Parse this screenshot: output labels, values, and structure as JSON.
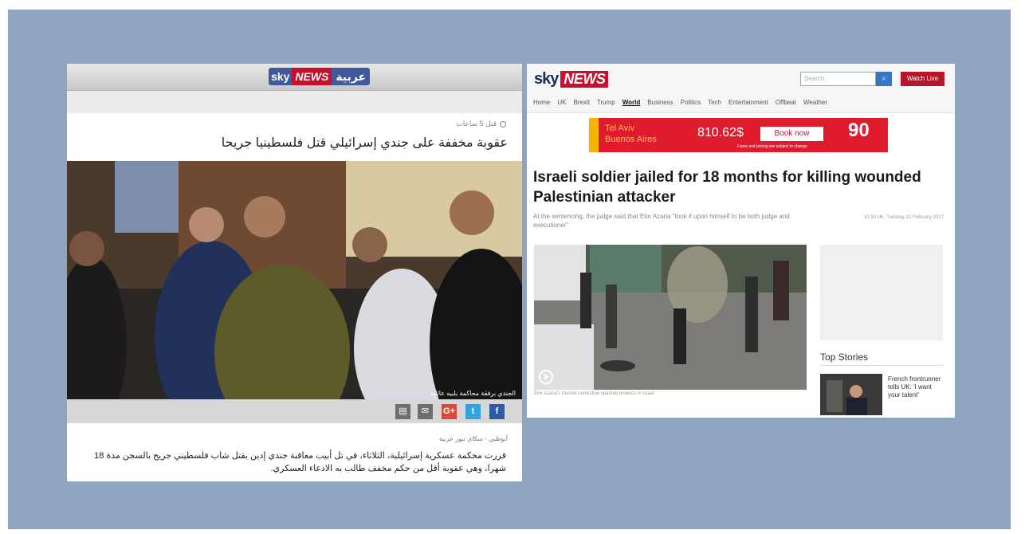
{
  "left_page": {
    "logo": {
      "sky": "sky",
      "news": "NEWS",
      "arabia": "عربية"
    },
    "meta": "قبل 5 ساعات",
    "title": "عقوبة مخففة على جندي إسرائيلي قتل فلسطينيا جريحا",
    "photo_caption": "الجندي برفقة محاكمة بلبيه عائلته",
    "share_icons": [
      "print-icon",
      "email-icon",
      "google-plus-icon",
      "twitter-icon",
      "facebook-icon"
    ],
    "share_labels": {
      "gplus": "G+",
      "facebook": "f",
      "twitter": "t"
    },
    "source": "أبوظبي - سكاي نيوز عربية",
    "body": "قررت محكمة عسكرية إسرائيلية، الثلاثاء، في تل أبيب معاقبة جندي إدين بقتل شاب فلسطيني جريح بالسجن مدة 18 شهرا، وهي عقوبة أقل من حكم مخفف طالب به الادعاء العسكري."
  },
  "right_page": {
    "logo": {
      "sky": "sky",
      "news": "NEWS"
    },
    "search_placeholder": "Search",
    "watch_live": "Watch Live",
    "nav": [
      "Home",
      "UK",
      "Brexit",
      "Trump",
      "World",
      "Business",
      "Politics",
      "Tech",
      "Entertainment",
      "Offbeat",
      "Weather"
    ],
    "nav_active": "World",
    "ad": {
      "city1": "Tel Aviv",
      "city2": "Buenos Aires",
      "price": "810.62$",
      "button": "Book now",
      "logo": "90",
      "small": "Fares and pricing are subject to change"
    },
    "headline": "Israeli soldier jailed for 18 months for killing wounded Palestinian attacker",
    "standfirst": "At the sentencing, the judge said that Elor Azaria \"took it upon himself to be both judge and executioner\"",
    "date": "10:30 UK, Tuesday 21 February 2017",
    "photo_caption": "Elor Azaria's murder conviction sparked protests in Israel",
    "top_stories_title": "Top Stories",
    "top_story": "French frontrunner tells UK: 'I want your talent'"
  },
  "colors": {
    "sky_red": "#c8102e",
    "sky_blue": "#3f5a9c",
    "frame": "#8ea4bf"
  }
}
